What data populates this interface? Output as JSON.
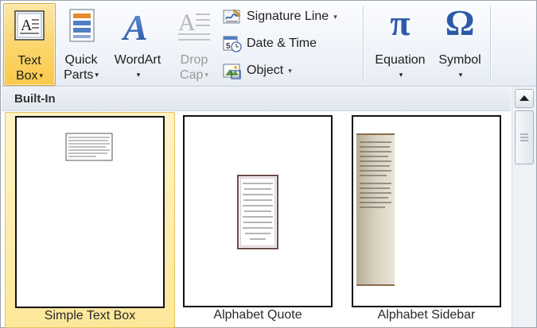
{
  "ribbon": {
    "text_box": {
      "line1": "Text",
      "line2": "Box",
      "icon": "text-box-icon"
    },
    "quick_parts": {
      "line1": "Quick",
      "line2": "Parts",
      "icon": "quick-parts-icon"
    },
    "wordart": {
      "label": "WordArt",
      "icon": "wordart-icon"
    },
    "drop_cap": {
      "line1": "Drop",
      "line2": "Cap",
      "icon": "drop-cap-icon"
    },
    "signature_line": {
      "label": "Signature Line",
      "icon": "signature-line-icon"
    },
    "date_time": {
      "label": "Date & Time",
      "icon": "calendar-clock-icon"
    },
    "object": {
      "label": "Object",
      "icon": "object-icon"
    },
    "equation": {
      "label": "Equation",
      "icon": "pi-icon",
      "glyph": "π"
    },
    "symbol": {
      "label": "Symbol",
      "icon": "omega-icon",
      "glyph": "Ω"
    },
    "dropdown_glyph": "▾"
  },
  "gallery": {
    "section_title": "Built-In",
    "items": [
      {
        "label": "Simple Text Box",
        "selected": true
      },
      {
        "label": "Alphabet Quote",
        "selected": false
      },
      {
        "label": "Alphabet Sidebar",
        "selected": false
      }
    ]
  },
  "colors": {
    "selection": "#fbd56a",
    "accent_blue": "#2b5aa8",
    "sidebar_tan": "#cfc6b0"
  }
}
